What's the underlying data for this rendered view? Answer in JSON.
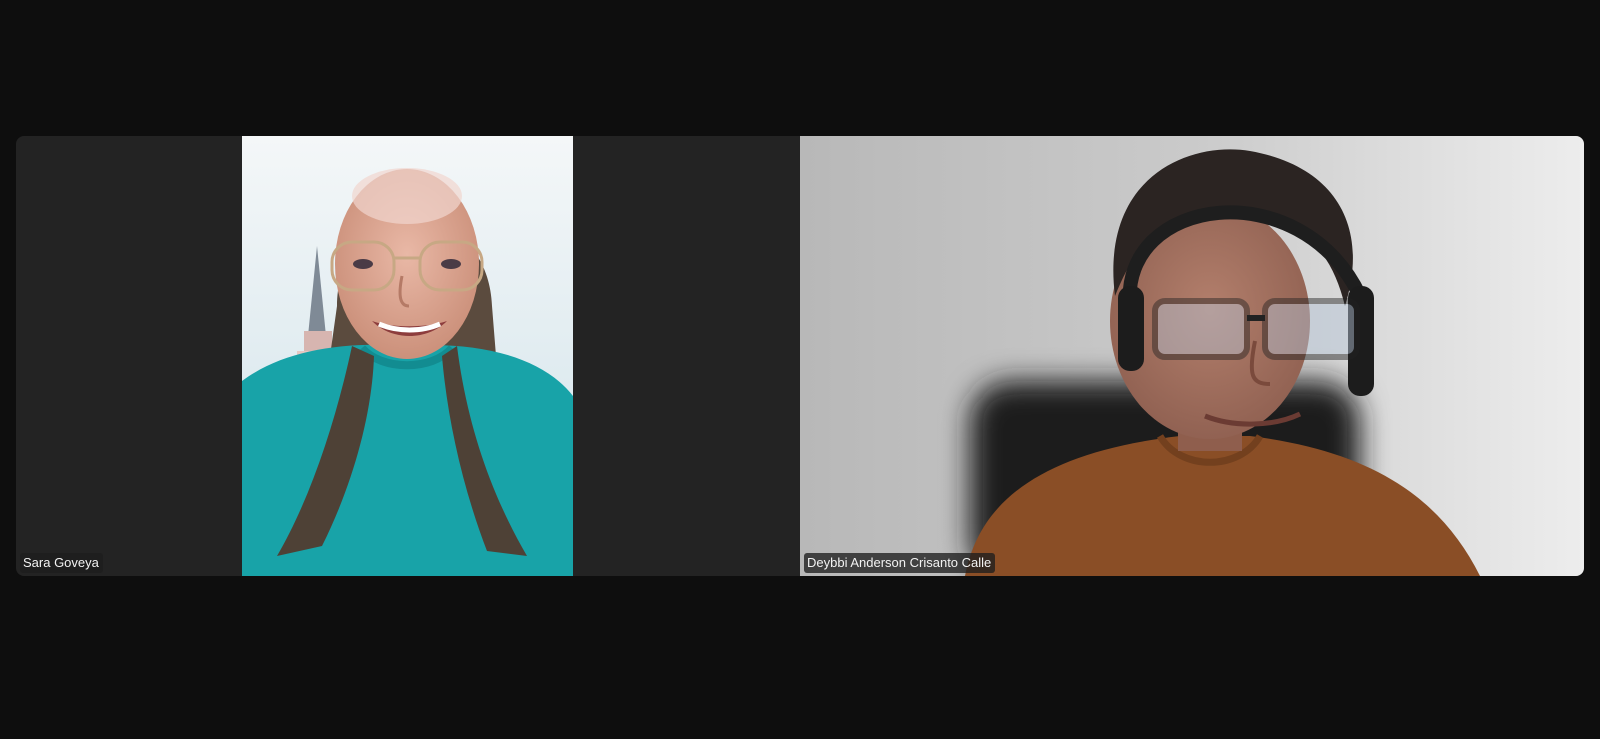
{
  "meeting": {
    "participants": [
      {
        "name": "Sara Goveya",
        "video": "on",
        "video_description": "portrait-camera-feed"
      },
      {
        "name": "Deybbi Anderson Crisanto Calle",
        "video": "on",
        "video_description": "landscape-camera-feed"
      }
    ]
  },
  "colors": {
    "background": "#0e0e0e",
    "tile_background": "#232323",
    "badge_text": "#f2f2f2"
  }
}
